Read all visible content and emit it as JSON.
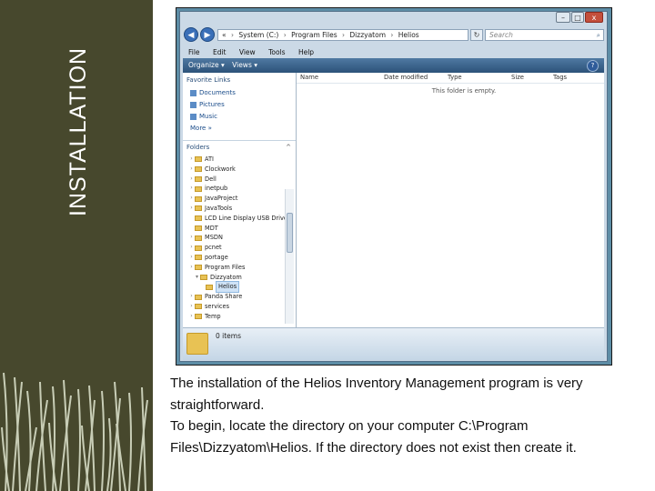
{
  "slide": {
    "title": "INSTALLATION",
    "paragraph1": "The installation of the Helios Inventory Management program is very straightforward.",
    "paragraph2": "To begin, locate the directory on your computer C:\\Program Files\\Dizzyatom\\Helios. If the directory does not exist then create it."
  },
  "explorer": {
    "window_buttons": {
      "minimize": "–",
      "maximize": "□",
      "close": "x"
    },
    "nav": {
      "back": "◀",
      "forward": "▶"
    },
    "address": {
      "prefix": "«",
      "parts": [
        "System (C:)",
        "Program Files",
        "Dizzyatom",
        "Helios"
      ]
    },
    "refresh_glyph": "↻",
    "search": {
      "placeholder": "Search"
    },
    "menu": [
      "File",
      "Edit",
      "View",
      "Tools",
      "Help"
    ],
    "toolbar": {
      "organize": "Organize ▾",
      "views": "Views ▾",
      "help": "?"
    },
    "favorites": {
      "header": "Favorite Links",
      "items": [
        "Documents",
        "Pictures",
        "Music"
      ],
      "more": "More »"
    },
    "folders_header": "Folders",
    "tree": [
      {
        "label": "ATI",
        "indent": 1,
        "twisty": "›"
      },
      {
        "label": "Clockwork",
        "indent": 1,
        "twisty": "›"
      },
      {
        "label": "Dell",
        "indent": 1,
        "twisty": "›"
      },
      {
        "label": "inetpub",
        "indent": 1,
        "twisty": "›"
      },
      {
        "label": "JavaProject",
        "indent": 1,
        "twisty": "›"
      },
      {
        "label": "JavaTools",
        "indent": 1,
        "twisty": "›"
      },
      {
        "label": "LCD Line Display USB Driver",
        "indent": 1,
        "twisty": ""
      },
      {
        "label": "MDT",
        "indent": 1,
        "twisty": ""
      },
      {
        "label": "MSDN",
        "indent": 1,
        "twisty": "›"
      },
      {
        "label": "pcnet",
        "indent": 1,
        "twisty": "›"
      },
      {
        "label": "portage",
        "indent": 1,
        "twisty": "›"
      },
      {
        "label": "Program Files",
        "indent": 1,
        "twisty": "›"
      },
      {
        "label": "Dizzyatom",
        "indent": 2,
        "twisty": "▾"
      },
      {
        "label": "Helios",
        "indent": 3,
        "twisty": "",
        "selected": true
      },
      {
        "label": "Panda Share",
        "indent": 1,
        "twisty": "›"
      },
      {
        "label": "services",
        "indent": 1,
        "twisty": "›"
      },
      {
        "label": "Temp",
        "indent": 1,
        "twisty": "›"
      }
    ],
    "columns": [
      "Name",
      "Date modified",
      "Type",
      "Size",
      "Tags"
    ],
    "empty_message": "This folder is empty.",
    "status": "0 items"
  }
}
